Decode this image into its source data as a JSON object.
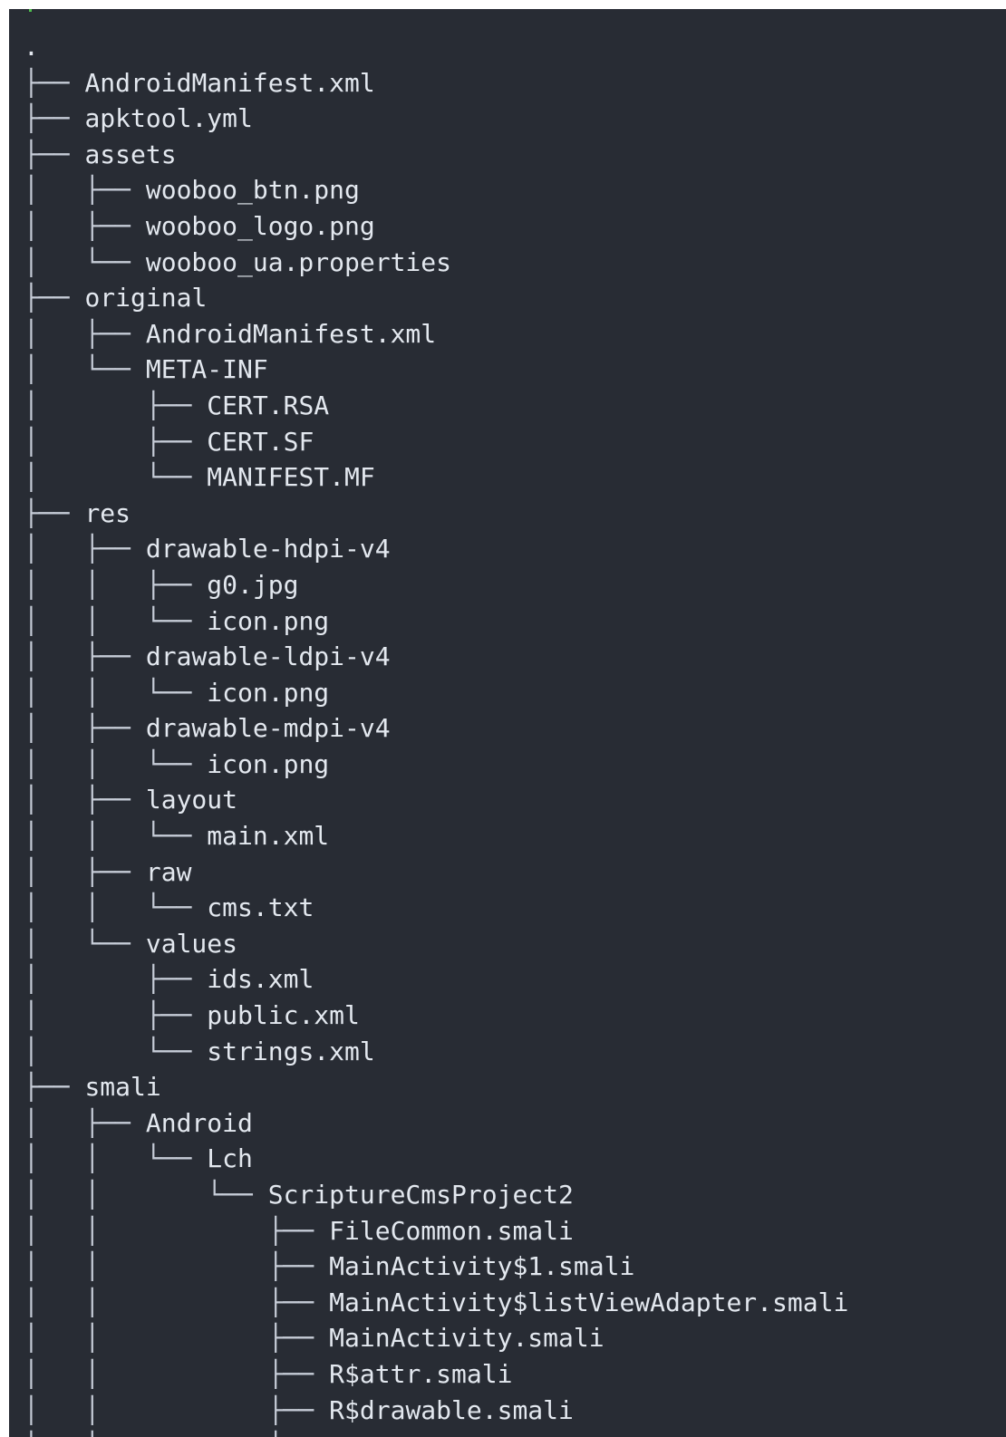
{
  "terminal": {
    "lines": [
      {
        "prefix": "",
        "name": "."
      },
      {
        "prefix": "├── ",
        "name": "AndroidManifest.xml"
      },
      {
        "prefix": "├── ",
        "name": "apktool.yml"
      },
      {
        "prefix": "├── ",
        "name": "assets"
      },
      {
        "prefix": "│   ├── ",
        "name": "wooboo_btn.png"
      },
      {
        "prefix": "│   ├── ",
        "name": "wooboo_logo.png"
      },
      {
        "prefix": "│   └── ",
        "name": "wooboo_ua.properties"
      },
      {
        "prefix": "├── ",
        "name": "original"
      },
      {
        "prefix": "│   ├── ",
        "name": "AndroidManifest.xml"
      },
      {
        "prefix": "│   └── ",
        "name": "META-INF"
      },
      {
        "prefix": "│       ├── ",
        "name": "CERT.RSA"
      },
      {
        "prefix": "│       ├── ",
        "name": "CERT.SF"
      },
      {
        "prefix": "│       └── ",
        "name": "MANIFEST.MF"
      },
      {
        "prefix": "├── ",
        "name": "res"
      },
      {
        "prefix": "│   ├── ",
        "name": "drawable-hdpi-v4"
      },
      {
        "prefix": "│   │   ├── ",
        "name": "g0.jpg"
      },
      {
        "prefix": "│   │   └── ",
        "name": "icon.png"
      },
      {
        "prefix": "│   ├── ",
        "name": "drawable-ldpi-v4"
      },
      {
        "prefix": "│   │   └── ",
        "name": "icon.png"
      },
      {
        "prefix": "│   ├── ",
        "name": "drawable-mdpi-v4"
      },
      {
        "prefix": "│   │   └── ",
        "name": "icon.png"
      },
      {
        "prefix": "│   ├── ",
        "name": "layout"
      },
      {
        "prefix": "│   │   └── ",
        "name": "main.xml"
      },
      {
        "prefix": "│   ├── ",
        "name": "raw"
      },
      {
        "prefix": "│   │   └── ",
        "name": "cms.txt"
      },
      {
        "prefix": "│   └── ",
        "name": "values"
      },
      {
        "prefix": "│       ├── ",
        "name": "ids.xml"
      },
      {
        "prefix": "│       ├── ",
        "name": "public.xml"
      },
      {
        "prefix": "│       └── ",
        "name": "strings.xml"
      },
      {
        "prefix": "├── ",
        "name": "smali"
      },
      {
        "prefix": "│   ├── ",
        "name": "Android"
      },
      {
        "prefix": "│   │   └── ",
        "name": "Lch"
      },
      {
        "prefix": "│   │       └── ",
        "name": "ScriptureCmsProject2"
      },
      {
        "prefix": "│   │           ├── ",
        "name": "FileCommon.smali"
      },
      {
        "prefix": "│   │           ├── ",
        "name": "MainActivity$1.smali"
      },
      {
        "prefix": "│   │           ├── ",
        "name": "MainActivity$listViewAdapter.smali"
      },
      {
        "prefix": "│   │           ├── ",
        "name": "MainActivity.smali"
      },
      {
        "prefix": "│   │           ├── ",
        "name": "R$attr.smali"
      },
      {
        "prefix": "│   │           ├── ",
        "name": "R$drawable.smali"
      },
      {
        "prefix": "│   │           ├── ",
        "name": ""
      }
    ]
  }
}
